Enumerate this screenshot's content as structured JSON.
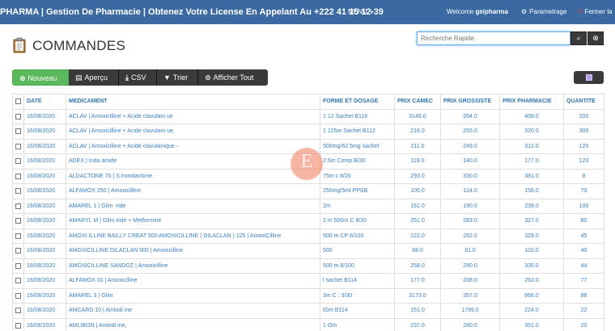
{
  "navbar": {
    "brand": "PHARMA | Gestion De Pharmacie | Obtenez Votre License En Appelant Au +222 41 15 12 39",
    "menu_label": "MENU",
    "welcome_prefix": "Welcome",
    "username": "geipharma",
    "settings_label": "Parametrage",
    "logout_label": "Fermer la"
  },
  "page": {
    "title": "COMMANDES"
  },
  "search": {
    "placeholder": "Recherche Rapide"
  },
  "toolbar": {
    "new_label": "Nouveau",
    "preview_label": "Aperçu",
    "csv_label": "CSV",
    "sort_label": "Trier",
    "show_all_label": "Afficher Tout"
  },
  "table": {
    "headers": [
      "DATE",
      "MEDICAMENT",
      "FORME ET DOSAGE",
      "PRIX CAMEC",
      "PRIX GROSSISTE",
      "PRIX PHARMACIE",
      "QUANTITE"
    ],
    "rows": [
      [
        "16/08/2020",
        "ACLAV | Amoxicilline + Acide clavulani ue",
        "1 12 Sachet B116",
        "3146.0",
        "354.0",
        "408.0",
        "200"
      ],
      [
        "16/08/2020",
        "ACLAV | Amoxicilline + Acide clavulani ue,",
        "1 125m Sachet B112",
        "216.0",
        "255.0",
        "320.0",
        "300"
      ],
      [
        "16/08/2020",
        "ACLAV | Amoxicilline + Acide clavulanique -",
        "500mg/62.5mg sachet",
        "211.0",
        "249.0",
        "312.0",
        "120"
      ],
      [
        "16/08/2020",
        "ADEX | Inda amide",
        "2.5m Comp.B/30",
        "119.0",
        "140.0",
        "177.0",
        "120"
      ],
      [
        "16/08/2020",
        "ALDACTONE 75 | S ironolactone",
        "75m c 8/20",
        "293.0",
        "330.0",
        "381.0",
        "8"
      ],
      [
        "16/08/2020",
        "ALFAMOX 250 | Amoxicilline",
        "250mg/5ml PPSB",
        "105.0",
        "124.0",
        "156.0",
        "70"
      ],
      [
        "16/08/2020",
        "AMAREL 1 | Glim -ride",
        "2m",
        "161.0",
        "190.0",
        "239.0",
        "100"
      ],
      [
        "16/08/2020",
        "AMARYL M | Glim iride + Metformine",
        "2 m 500rn C 8/30",
        "251.0",
        "283.0",
        "327.0",
        "80"
      ],
      [
        "16/08/2020",
        "AMOXI ILLINE BAILLY CREAT 500 AMOXICILLINE ( DILACLAN ) 125 | AmoxiÇilline",
        "500 m CP 8/100",
        "222.0",
        "262.0",
        "329.0",
        "45"
      ],
      [
        "16/08/2020",
        "AMOXICILLINE DILACLAN 500 | Amoxicilline",
        "500",
        "68.0",
        "81.0",
        "102.0",
        "40"
      ],
      [
        "16/08/2020",
        "AMOXICILLINE SANDOZ | Amoxicilline",
        "500 m 8/100",
        "258.0",
        "290.0",
        "335.0",
        "44"
      ],
      [
        "16/08/2020",
        "ALFAMOX IG | Amoxicilline",
        "l sachet B114",
        "177.0",
        "208.0",
        "262.0",
        "77"
      ],
      [
        "16/08/2020",
        "AMAREL 3 | Glim",
        "3m C . 3/30",
        "3173.0",
        "357.0",
        "666.0",
        "88"
      ],
      [
        "16/08/2020",
        "AMCARD 10 | Amlodi ine",
        "lOm B114",
        "151.0",
        "1789.0",
        "224.0",
        "22"
      ],
      [
        "16/08/2020",
        "AMLIBON | Amlodi ine,",
        "1 Om",
        "237.0",
        "280.0",
        "351.0",
        "20"
      ]
    ]
  },
  "watermark": {
    "letter": "E"
  },
  "colors": {
    "navbar": "#3b6aa3",
    "link": "#3a7fc1",
    "success": "#5cb85c",
    "dark_button": "#3a3a3a"
  }
}
